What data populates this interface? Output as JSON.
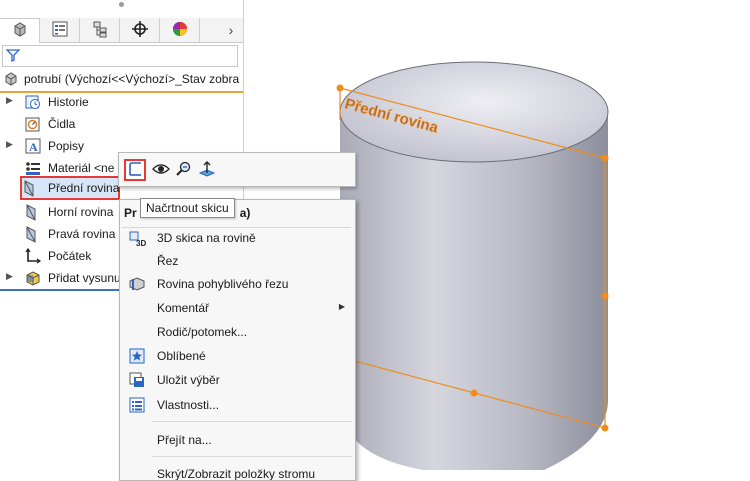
{
  "tabs": [
    {
      "icon": "feature-manager-icon"
    },
    {
      "icon": "property-manager-icon"
    },
    {
      "icon": "configuration-manager-icon"
    },
    {
      "icon": "dimxpert-icon"
    },
    {
      "icon": "display-manager-icon"
    }
  ],
  "tabs_more": "›",
  "root": {
    "label": "potrubí  (Výchozí<<Výchozí>_Stav zobra"
  },
  "tree": [
    {
      "label": "Historie",
      "icon": "history-icon",
      "expandable": true
    },
    {
      "label": "Čidla",
      "icon": "sensors-icon",
      "expandable": false
    },
    {
      "label": "Popisy",
      "icon": "annotations-icon",
      "expandable": true
    },
    {
      "label": "Materiál <ne",
      "icon": "material-icon",
      "expandable": false
    },
    {
      "label": "Přední rovina",
      "icon": "plane-icon",
      "expandable": false,
      "selected": true
    },
    {
      "label": "Horní rovina",
      "icon": "plane-icon",
      "expandable": false
    },
    {
      "label": "Pravá rovina",
      "icon": "plane-icon",
      "expandable": false
    },
    {
      "label": "Počátek",
      "icon": "origin-icon",
      "expandable": false
    },
    {
      "label": "Přidat vysunu",
      "icon": "extrude-icon",
      "expandable": true
    }
  ],
  "context_toolbar": {
    "buttons": [
      "sketch-icon",
      "show-icon",
      "zoom-to-selection-icon",
      "normal-to-icon"
    ]
  },
  "tooltip": "Načrtnout skicu",
  "menu": {
    "title": "Pr",
    "title_suffix": "a)",
    "items": [
      {
        "label": "3D skica na rovině",
        "icon": "3d-sketch-icon",
        "submenu": false
      },
      {
        "label": "Řez",
        "icon": "",
        "submenu": false
      },
      {
        "label": "Rovina pohyblivého řezu",
        "icon": "moving-section-icon",
        "submenu": false
      },
      {
        "label": "Komentář",
        "icon": "",
        "submenu": true
      },
      {
        "label": "Rodič/potomek...",
        "icon": "",
        "submenu": false
      },
      {
        "label": "Oblíbené",
        "icon": "favorites-icon",
        "submenu": false
      },
      {
        "label": "Uložit výběr",
        "icon": "save-selection-icon",
        "submenu": false
      },
      {
        "label": "Vlastnosti...",
        "icon": "properties-icon",
        "submenu": false
      },
      {
        "label": "Přejít na...",
        "icon": "",
        "submenu": false
      },
      {
        "label": "Skrýt/Zobrazit položky stromu",
        "icon": "",
        "submenu": false
      }
    ]
  },
  "viewport": {
    "plane_label": "Přední rovina",
    "plane_color": "#f08c1e",
    "model_color": "#c9cbd6"
  }
}
